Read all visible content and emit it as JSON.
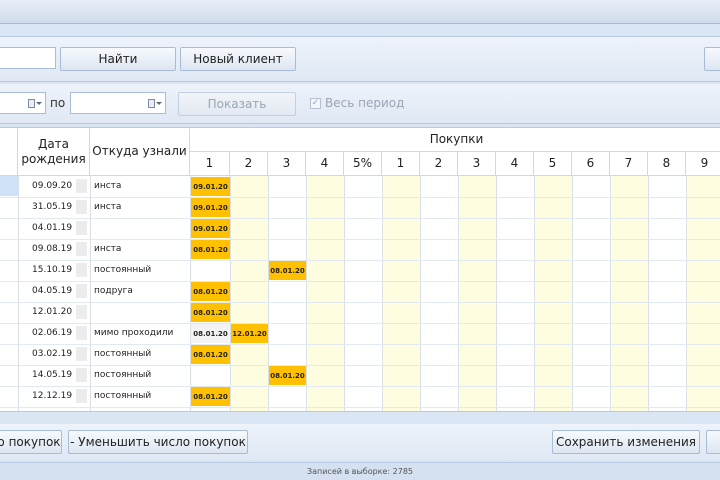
{
  "toolbar": {
    "find_label": "Найти",
    "new_client_label": "Новый клиент"
  },
  "filter": {
    "to_label": "по",
    "show_label": "Показать",
    "whole_period_label": "Весь период"
  },
  "grid": {
    "headers": {
      "birthdate": "Дата рождения",
      "source": "Откуда узнали",
      "purchases": "Покупки"
    },
    "sub_headers": [
      "1",
      "2",
      "3",
      "4",
      "5%",
      "1",
      "2",
      "3",
      "4",
      "5",
      "6",
      "7",
      "8",
      "9"
    ],
    "rows": [
      {
        "birth": "09.09.20",
        "source": "инста",
        "p": [
          "09.01.20",
          "",
          ""
        ]
      },
      {
        "birth": "31.05.19",
        "source": "инста",
        "p": [
          "09.01.20",
          "",
          ""
        ]
      },
      {
        "birth": "04.01.19",
        "source": "",
        "p": [
          "09.01.20",
          "",
          ""
        ]
      },
      {
        "birth": "09.08.19",
        "source": "инста",
        "p": [
          "08.01.20",
          "",
          ""
        ]
      },
      {
        "birth": "15.10.19",
        "source": "постоянный",
        "p": [
          "",
          "",
          "08.01.20"
        ]
      },
      {
        "birth": "04.05.19",
        "source": "подруга",
        "p": [
          "08.01.20",
          "",
          ""
        ]
      },
      {
        "birth": "12.01.20",
        "source": "",
        "p": [
          "08.01.20",
          "",
          ""
        ]
      },
      {
        "birth": "02.06.19",
        "source": "мимо проходили",
        "p": [
          "08.01.20",
          "12.01.20",
          ""
        ]
      },
      {
        "birth": "03.02.19",
        "source": "постоянный",
        "p": [
          "08.01.20",
          "",
          ""
        ]
      },
      {
        "birth": "14.05.19",
        "source": "постоянный",
        "p": [
          "",
          "",
          "08.01.20"
        ]
      },
      {
        "birth": "12.12.19",
        "source": "постоянный",
        "p": [
          "08.01.20",
          "",
          ""
        ]
      }
    ]
  },
  "bottom": {
    "add_label": "о покупок",
    "reduce_label": "- Уменьшить число покупок",
    "save_label": "Сохранить изменения"
  },
  "status": {
    "records": "Записей в выборке: 2785"
  },
  "colors": {
    "badge": "#ffc000",
    "alt_col": "#fffde0",
    "accent_blue": "#cfe2f8"
  }
}
